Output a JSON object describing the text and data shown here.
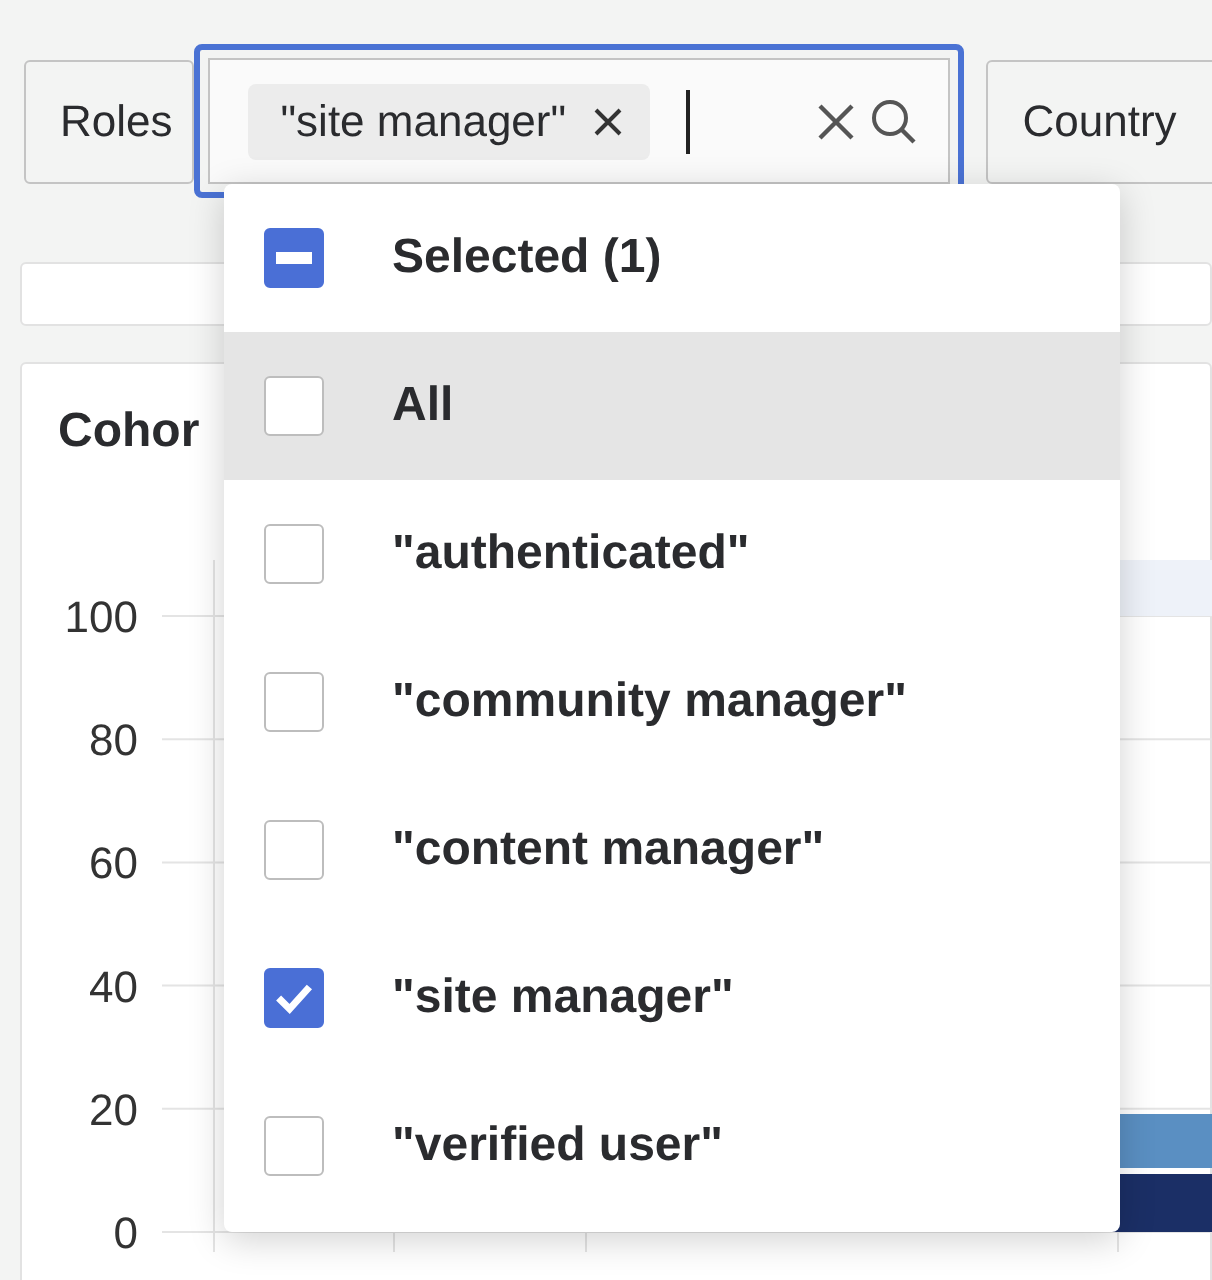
{
  "filters": {
    "roles_label": "Roles",
    "chips": [
      {
        "label": "\"site manager\""
      }
    ],
    "country_label": "Country"
  },
  "dropdown": {
    "summary": {
      "label": "Selected (1)",
      "indeterminate": true
    },
    "options": [
      {
        "label": "All",
        "checked": false,
        "highlighted": true
      },
      {
        "label": "\"authenticated\"",
        "checked": false,
        "highlighted": false
      },
      {
        "label": "\"community manager\"",
        "checked": false,
        "highlighted": false
      },
      {
        "label": "\"content manager\"",
        "checked": false,
        "highlighted": false
      },
      {
        "label": "\"site manager\"",
        "checked": true,
        "highlighted": false
      },
      {
        "label": "\"verified user\"",
        "checked": false,
        "highlighted": false
      }
    ]
  },
  "chart_card": {
    "title": "Cohor",
    "y_ticks": [
      "100",
      "80",
      "60",
      "40",
      "20",
      "0"
    ]
  }
}
